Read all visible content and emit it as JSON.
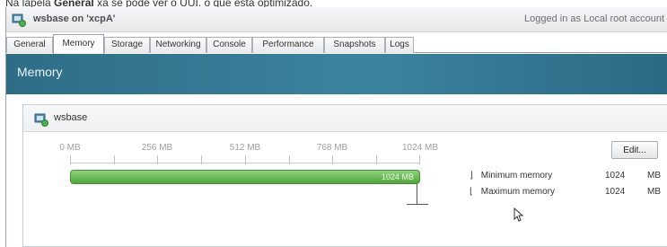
{
  "caption": {
    "prefix": "Na lapela",
    "bold": "General",
    "rest": "xa se pode ver o UUI. o que está optimizado."
  },
  "window": {
    "title": "wsbase on 'xcpA'",
    "login_prefix": "Logged in as",
    "login_account": "Local root account"
  },
  "tabs": [
    {
      "label": "General",
      "active": false
    },
    {
      "label": "Memory",
      "active": true
    },
    {
      "label": "Storage",
      "active": false
    },
    {
      "label": "Networking",
      "active": false
    },
    {
      "label": "Console",
      "active": false
    },
    {
      "label": "Performance",
      "active": false
    },
    {
      "label": "Snapshots",
      "active": false
    },
    {
      "label": "Logs",
      "active": false
    }
  ],
  "banner": {
    "title": "Memory"
  },
  "panel": {
    "vm_name": "wsbase",
    "scale": [
      "0 MB",
      "256 MB",
      "512 MB",
      "768 MB",
      "1024 MB"
    ],
    "bar": {
      "label": "1024 MB",
      "fraction": 1.0
    },
    "edit_label": "Edit...",
    "rows": [
      {
        "glyph": "⌋",
        "label": "Minimum memory",
        "value": "1024",
        "unit": "MB"
      },
      {
        "glyph": "⌊",
        "label": "Maximum memory",
        "value": "1024",
        "unit": "MB"
      }
    ]
  },
  "colors": {
    "banner": "#3b84a0",
    "bar": "#5cb345",
    "accent_icon": "#4caf50"
  }
}
